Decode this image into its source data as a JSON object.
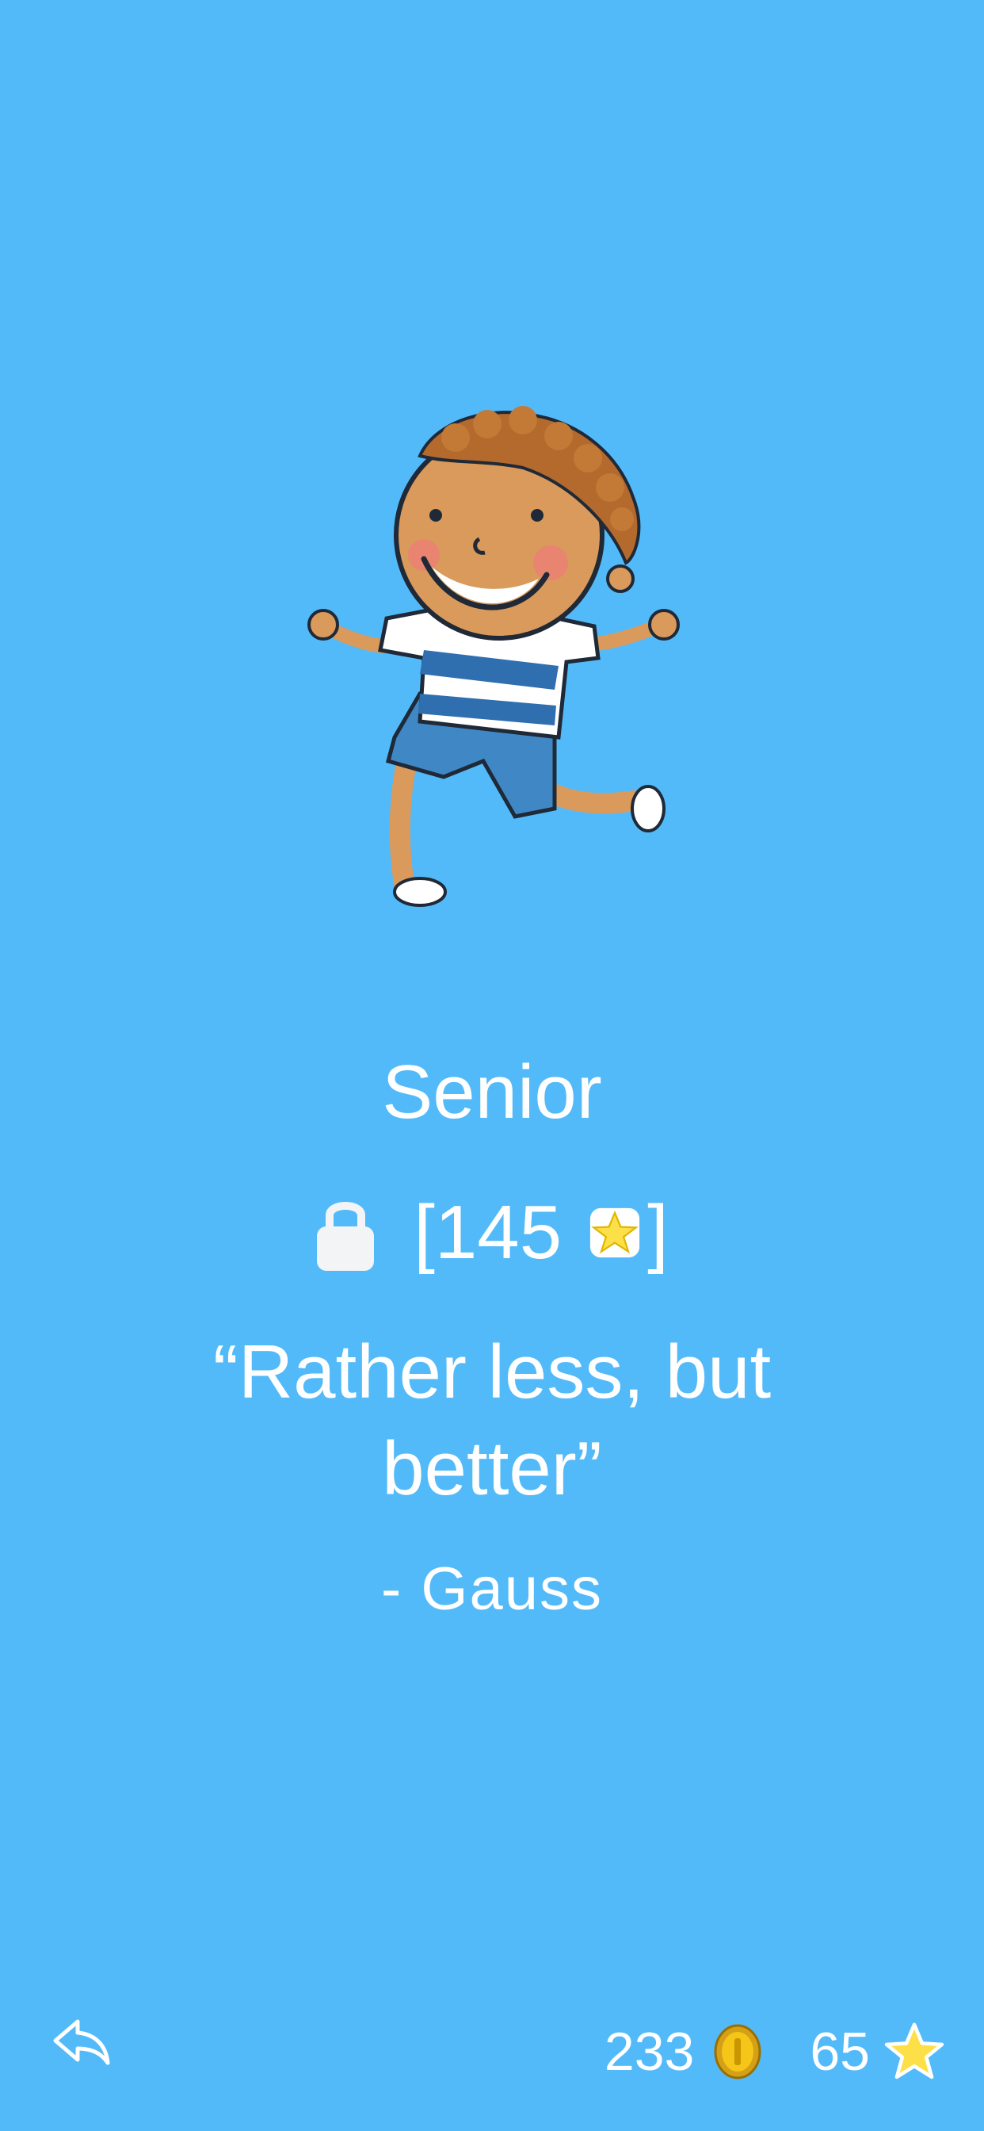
{
  "level": {
    "title": "Senior",
    "required_stars": "[145",
    "bracket_close": "]",
    "locked": true
  },
  "quote": {
    "text": "“Rather less, but better”",
    "author": "- Gauss"
  },
  "footer": {
    "back_icon": "back-arrow-icon",
    "coins": "233",
    "stars": "65"
  },
  "colors": {
    "background": "#53baf9",
    "text": "#ffffff",
    "star": "#fde047",
    "coin": "#f5c518"
  }
}
